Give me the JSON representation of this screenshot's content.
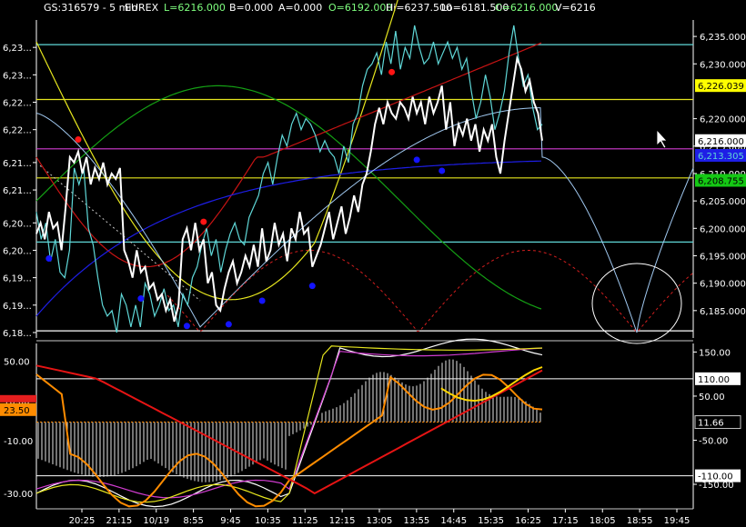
{
  "header": {
    "symbol": "GS:316579 - 5 min",
    "exchange": "EUREX",
    "last": "L=6216.000",
    "bid": "B=0.000",
    "ask": "A=0.000",
    "open": "O=6192.000",
    "high": "Hi=6237.500",
    "low": "Lo=6181.500",
    "close": "C=6216.000",
    "volume": "V=6216"
  },
  "colors": {
    "price": "#ffffff",
    "cyan": "#5fd7d7",
    "red_ma": "#c81414",
    "yellow_ma": "#e6e61e",
    "green_ma": "#14a014",
    "blue_ma": "#1e1ee6",
    "light_blue_curve": "#a0c8f0",
    "dashed_red": "#d21e1e",
    "magenta": "#d23cd2",
    "orange": "#ff8c00",
    "dot_blue": "#1414ff",
    "dot_red": "#ff1414"
  },
  "price_axis": {
    "left_labels": [
      "6,23...",
      "6,23...",
      "6,22...",
      "6,22...",
      "6,21...",
      "6,21...",
      "6,20...",
      "6,20...",
      "6,19...",
      "6,19...",
      "6,18..."
    ],
    "right_labels": [
      "6,235.000",
      "6,230.000",
      "6,220.000",
      "6,215.000",
      "6,210.000",
      "6,205.000",
      "6,200.000",
      "6,195.000",
      "6,190.000",
      "6,185.000"
    ],
    "range": [
      6180,
      6238
    ],
    "tags": [
      {
        "text": "6,226.039",
        "value": 6226.039,
        "bg": "#ffff00",
        "fg": "#000000"
      },
      {
        "text": "6,216.000",
        "value": 6216,
        "bg": "#ffffff",
        "fg": "#000000"
      },
      {
        "text": "6,213.305",
        "value": 6213.305,
        "bg": "#1e1ee6",
        "fg": "#5fd7d7"
      },
      {
        "text": "6,208.755",
        "value": 6208.755,
        "bg": "#14c814",
        "fg": "#000000"
      }
    ]
  },
  "indicator_axis": {
    "left_labels": [
      "50.00",
      "10.00",
      "-10.00",
      "-30.00"
    ],
    "right_labels": [
      "150.00",
      "50.00",
      "-50.00",
      "-150.00"
    ],
    "left_tag": {
      "text": "23.50",
      "bg": "#e61e1e",
      "fg": "#ffffff"
    },
    "right_tags": [
      {
        "text": "110.00",
        "value": 110,
        "bg": "#ffffff",
        "fg": "#000000"
      },
      {
        "text": "11.66",
        "value": 11.66,
        "bg": "#000000",
        "fg": "#ffffff"
      },
      {
        "text": "-110.00",
        "value": -110,
        "bg": "#ffffff",
        "fg": "#000000"
      }
    ],
    "range": [
      -185,
      190
    ]
  },
  "time_axis": {
    "labels": [
      "20:25",
      "21:15",
      "10/19",
      "8:55",
      "9:45",
      "10:35",
      "11:25",
      "12:15",
      "13:05",
      "13:55",
      "14:45",
      "15:35",
      "16:25",
      "17:15",
      "18:05",
      "18:55",
      "19:45"
    ]
  },
  "chart_data": {
    "type": "line",
    "price": [
      6199,
      6201,
      6198,
      6203,
      6200,
      6201,
      6196,
      6204,
      6213,
      6212,
      6214,
      6210,
      6213,
      6208,
      6211,
      6209,
      6212,
      6208,
      6210,
      6209,
      6211,
      6196,
      6194,
      6191,
      6196,
      6192,
      6193,
      6189,
      6190,
      6187,
      6188,
      6185,
      6187,
      6183,
      6186,
      6198,
      6200,
      6196,
      6201,
      6196,
      6198,
      6190,
      6192,
      6186,
      6185,
      6189,
      6192,
      6194,
      6190,
      6192,
      6195,
      6193,
      6197,
      6193,
      6200,
      6194,
      6196,
      6201,
      6197,
      6199,
      6194,
      6200,
      6198,
      6203,
      6199,
      6200,
      6193,
      6195,
      6197,
      6200,
      6203,
      6198,
      6201,
      6204,
      6199,
      6202,
      6206,
      6203,
      6208,
      6210,
      6214,
      6219,
      6222,
      6219,
      6223,
      6221,
      6220,
      6223,
      6222,
      6220,
      6224,
      6221,
      6223,
      6219,
      6224,
      6221,
      6223,
      6226,
      6218,
      6223,
      6215,
      6219,
      6217,
      6220,
      6216,
      6219,
      6214,
      6218,
      6216,
      6219,
      6213,
      6210,
      6216,
      6221,
      6226,
      6231,
      6229,
      6225,
      6227,
      6223,
      6221,
      6216
    ],
    "cyan": [
      6203,
      6198,
      6201,
      6194,
      6198,
      6192,
      6191,
      6196,
      6211,
      6208,
      6211,
      6200,
      6197,
      6191,
      6186,
      6184,
      6185,
      6181,
      6188,
      6186,
      6182,
      6186,
      6182,
      6190,
      6188,
      6184,
      6186,
      6189,
      6185,
      6186,
      6182,
      6188,
      6186,
      6191,
      6193,
      6197,
      6200,
      6195,
      6198,
      6192,
      6196,
      6199,
      6201,
      6198,
      6197,
      6202,
      6204,
      6206,
      6210,
      6212,
      6208,
      6213,
      6217,
      6215,
      6219,
      6221,
      6218,
      6220,
      6219,
      6217,
      6214,
      6216,
      6214,
      6213,
      6210,
      6215,
      6212,
      6219,
      6221,
      6226,
      6229,
      6230,
      6232,
      6228,
      6234,
      6230,
      6236,
      6229,
      6233,
      6231,
      6237,
      6233,
      6230,
      6231,
      6234,
      6230,
      6232,
      6234,
      6231,
      6233,
      6229,
      6231,
      6225,
      6220,
      6223,
      6228,
      6224,
      6218,
      6221,
      6225,
      6232,
      6237,
      6231,
      6226,
      6228,
      6222,
      6218,
      6219
    ],
    "markers_blue": [
      [
        6194.5,
        3
      ],
      [
        6187.2,
        25
      ],
      [
        6182.2,
        36
      ],
      [
        6182.5,
        46
      ],
      [
        6186.8,
        54
      ],
      [
        6189.5,
        66
      ],
      [
        6212.5,
        91
      ],
      [
        6210.5,
        97
      ]
    ],
    "markers_red": [
      [
        6216.2,
        10
      ],
      [
        6201.2,
        40
      ],
      [
        6228.5,
        85
      ]
    ]
  }
}
